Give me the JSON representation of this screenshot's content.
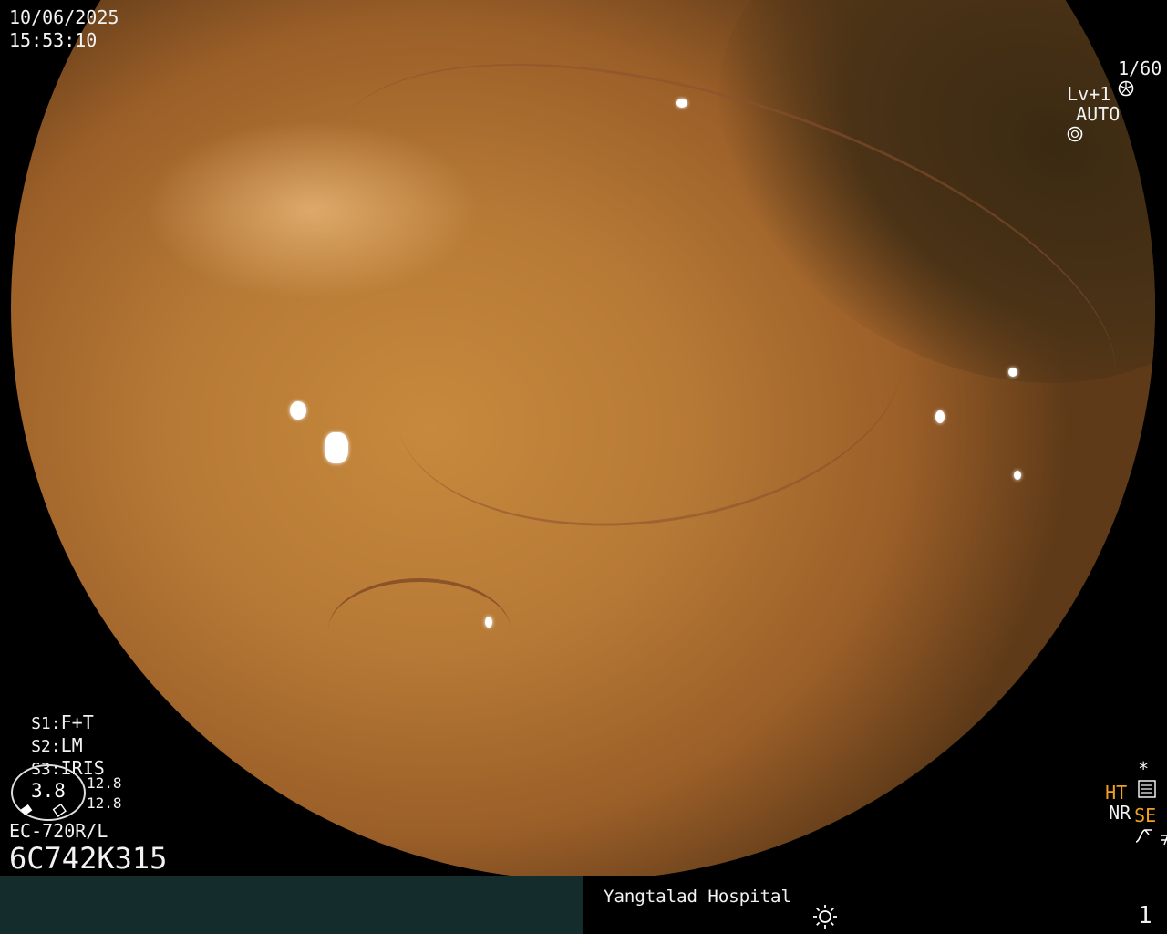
{
  "osd": {
    "date": "10/06/2025",
    "time": "15:53:10",
    "shutter": "1/60",
    "level": "Lv+1",
    "iris_mode": "AUTO",
    "s1_label": "S1:",
    "s1_value": "F+T",
    "s2_label": "S2:",
    "s2_value": "LM",
    "s3_label": "S3:",
    "s3_value": "IRIS",
    "gauge_value": "3.8",
    "gauge_side_top": "12.8",
    "gauge_side_bottom": "12.8",
    "scope_model": "EC-720R/L",
    "serial": "6C742K315",
    "asterisk": "*",
    "ht": "HT",
    "nr": "NR",
    "se": "SE",
    "hospital": "Yangtalad Hospital",
    "page": "1"
  },
  "icons": [
    "shutter-icon",
    "iris-icon",
    "settings-icon",
    "curve-icon",
    "no-signal-icon",
    "light-source-icon"
  ],
  "colors": {
    "accent_orange": "#f0a020",
    "bar": "#142c2c"
  }
}
